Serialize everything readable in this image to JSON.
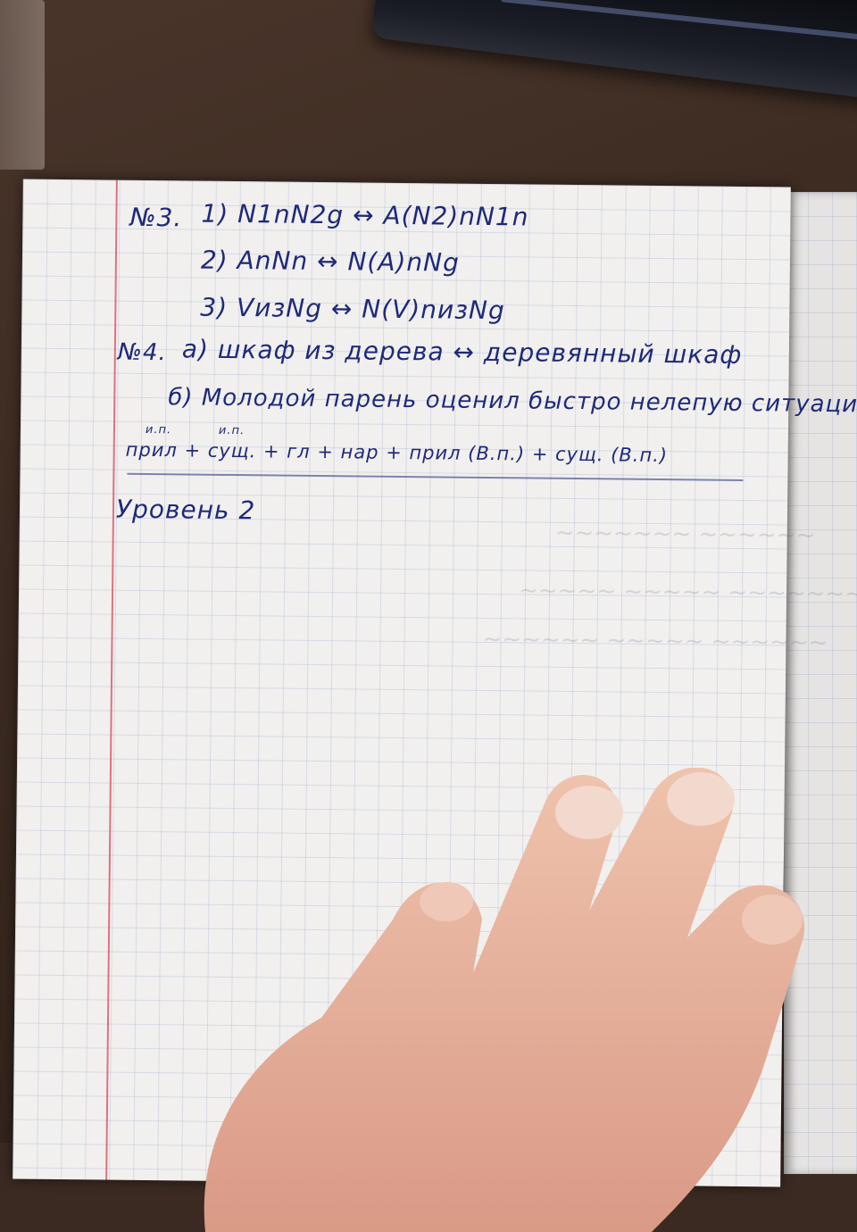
{
  "notebook": {
    "task3": {
      "number": "№3.",
      "line1": "1) N1nN2g ↔ A(N2)nN1n",
      "line2": "2) AnNn ↔ N(A)nNg",
      "line3": "3) VизNg ↔ N(V)nизNg"
    },
    "task4": {
      "number": "№4.",
      "line_a": "а) шкаф из дерева ↔ деревянный шкаф",
      "line_b": "б) Молодой парень оценил быстро нелепую ситуацию.",
      "annotation_1": "и.п.",
      "annotation_2": "и.п.",
      "formula": "прил + сущ. + гл + нар + прил (В.п.) + сущ. (В.п.)"
    },
    "level": "Уровень 2"
  },
  "colors": {
    "ink": "#1f2a78",
    "paper": "#f1f0ef",
    "grid": "#8c9cc0",
    "margin": "#dc465a"
  }
}
